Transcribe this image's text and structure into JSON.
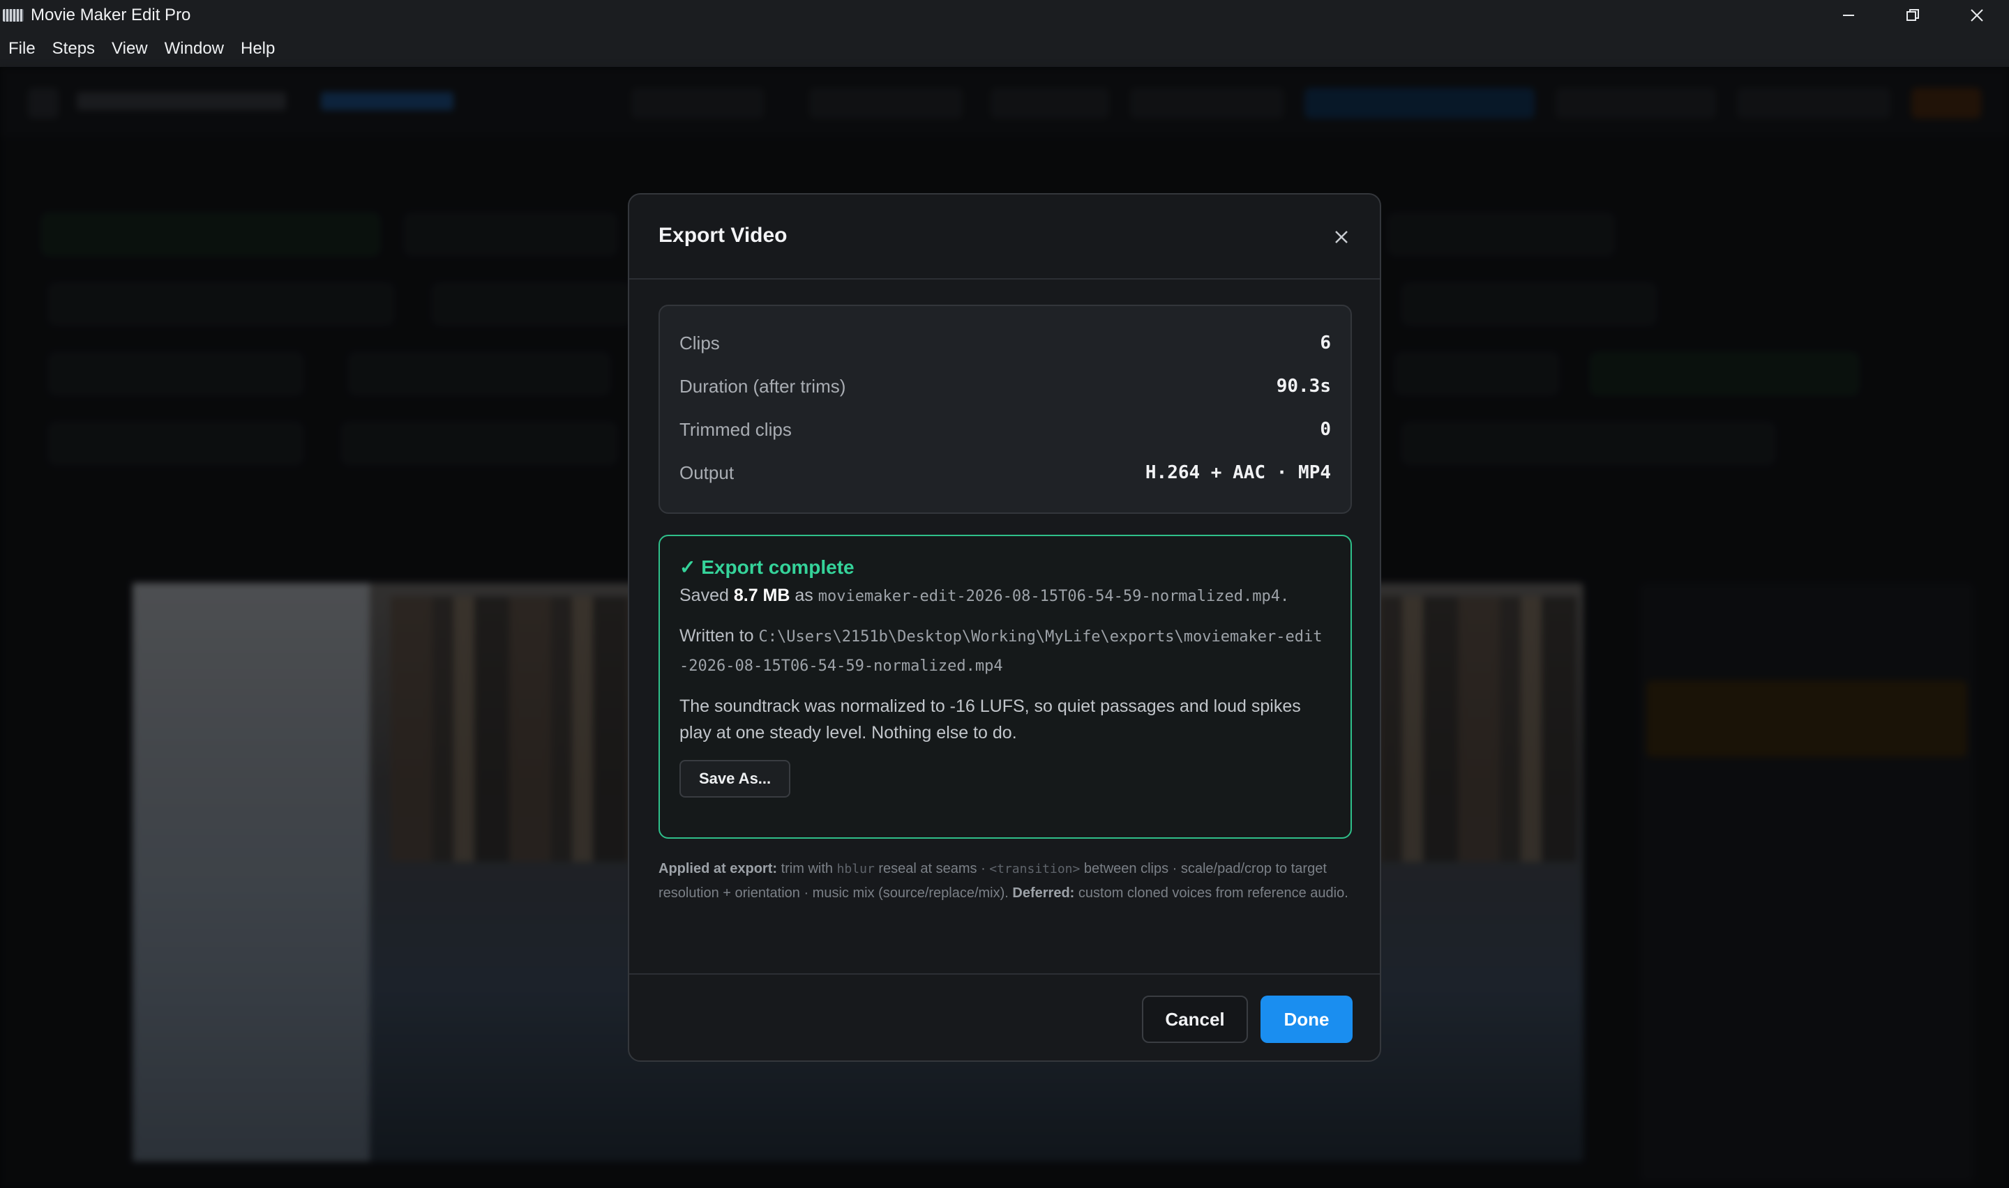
{
  "window": {
    "title": "Movie Maker Edit Pro",
    "menu": [
      "File",
      "Steps",
      "View",
      "Window",
      "Help"
    ]
  },
  "dialog": {
    "title": "Export Video",
    "summary": [
      {
        "label": "Clips",
        "value": "6"
      },
      {
        "label": "Duration (after trims)",
        "value": "90.3s"
      },
      {
        "label": "Trimmed clips",
        "value": "0"
      },
      {
        "label": "Output",
        "value": "H.264 + AAC · MP4"
      }
    ],
    "result": {
      "title": "✓ Export complete",
      "saved_prefix": "Saved",
      "size": "8.7 MB",
      "as_word": "as",
      "filename": "moviemaker-edit-2026-08-15T06-54-59-normalized.mp4.",
      "written_prefix": "Written to",
      "path": "C:\\Users\\2151b\\Desktop\\Working\\MyLife\\exports\\moviemaker-edit-2026-08-15T06-54-59-normalized.mp4",
      "description": "The soundtrack was normalized to -16 LUFS, so quiet passages and loud spikes play at one steady level. Nothing else to do.",
      "save_as_label": "Save As..."
    },
    "note": {
      "applied_label": "Applied at export:",
      "applied_part1": "trim with",
      "hblur": "hblur",
      "applied_part2": "reseal at seams ·",
      "transition": "<transition>",
      "applied_part3": "between clips · scale/pad/crop to target resolution + orientation · music mix (source/replace/mix).",
      "deferred_label": "Deferred:",
      "deferred_text": "custom cloned voices from reference audio."
    },
    "buttons": {
      "cancel": "Cancel",
      "done": "Done"
    }
  },
  "colors": {
    "accent": "#1a8ef0",
    "success": "#35d39a",
    "dialog_bg": "#17191c"
  }
}
